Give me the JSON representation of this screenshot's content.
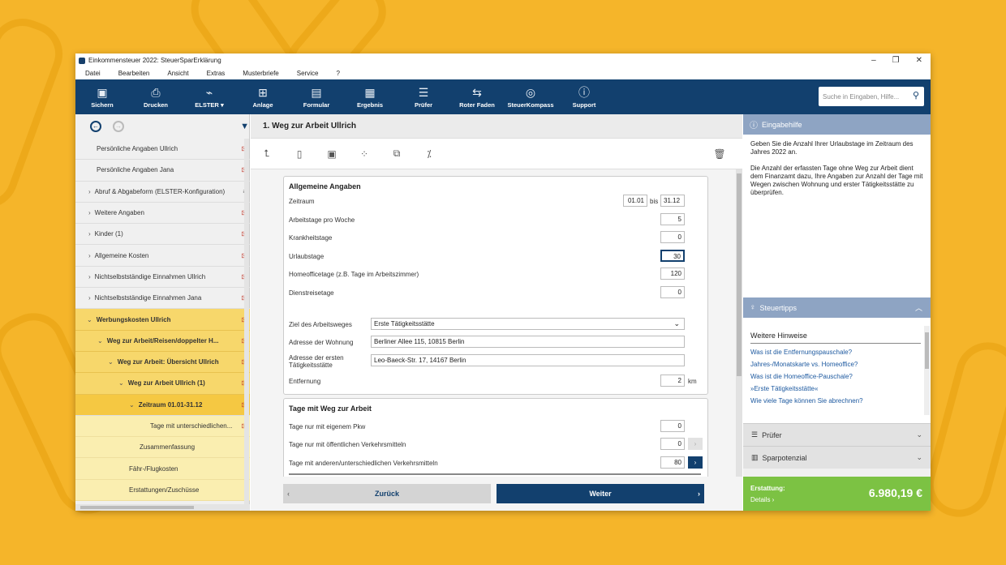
{
  "window": {
    "title": "Einkommensteuer 2022: SteuerSparErklärung"
  },
  "menu": [
    "Datei",
    "Bearbeiten",
    "Ansicht",
    "Extras",
    "Musterbriefe",
    "Service",
    "?"
  ],
  "toolbar": [
    {
      "label": "Sichern",
      "icon": "save-icon"
    },
    {
      "label": "Drucken",
      "icon": "print-icon"
    },
    {
      "label": "ELSTER",
      "icon": "elster-icon"
    },
    {
      "label": "Anlage",
      "icon": "add-document-icon"
    },
    {
      "label": "Formular",
      "icon": "form-icon"
    },
    {
      "label": "Ergebnis",
      "icon": "calculator-icon"
    },
    {
      "label": "Prüfer",
      "icon": "checklist-icon"
    },
    {
      "label": "Roter Faden",
      "icon": "signpost-icon"
    },
    {
      "label": "SteuerKompass",
      "icon": "compass-icon"
    },
    {
      "label": "Support",
      "icon": "help-icon"
    }
  ],
  "search": {
    "placeholder": "Suche in Eingaben, Hilfe..."
  },
  "tree": [
    {
      "label": "Persönliche Angaben Ullrich",
      "state": "normal"
    },
    {
      "label": "Persönliche Angaben Jana",
      "state": "normal"
    },
    {
      "label": "Abruf & Abgabeform (ELSTER-Konfiguration)",
      "state": "normal"
    },
    {
      "label": "Weitere Angaben",
      "state": "normal"
    },
    {
      "label": "Kinder (1)",
      "state": "normal"
    },
    {
      "label": "Allgemeine Kosten",
      "state": "normal"
    },
    {
      "label": "Nichtselbstständige Einnahmen Ullrich",
      "state": "normal"
    },
    {
      "label": "Nichtselbstständige Einnahmen Jana",
      "state": "normal"
    },
    {
      "label": "Werbungskosten Ullrich",
      "state": "sel"
    },
    {
      "label": "Weg zur Arbeit/Reisen/doppelter H...",
      "state": "sel"
    },
    {
      "label": "Weg zur Arbeit: Übersicht Ullrich",
      "state": "sel"
    },
    {
      "label": "Weg zur Arbeit Ullrich (1)",
      "state": "sel"
    },
    {
      "label": "Zeitraum 01.01-31.12",
      "state": "cur"
    },
    {
      "label": "Tage mit unterschiedlichen...",
      "state": "sub"
    },
    {
      "label": "Zusammenfassung",
      "state": "sub"
    },
    {
      "label": "Fähr-/Flugkosten",
      "state": "sub"
    },
    {
      "label": "Erstattungen/Zuschüsse",
      "state": "sub"
    }
  ],
  "page": {
    "title": "1. Weg zur Arbeit Ullrich"
  },
  "general": {
    "heading": "Allgemeine Angaben",
    "zeitraum_label": "Zeitraum",
    "zeitraum_from": "01.01",
    "bis": "bis",
    "zeitraum_to": "31.12",
    "arbeitstage_label": "Arbeitstage pro Woche",
    "arbeitstage": "5",
    "krank_label": "Krankheitstage",
    "krank": "0",
    "urlaub_label": "Urlaubstage",
    "urlaub": "30",
    "homeoffice_label": "Homeofficetage (z.B. Tage im Arbeitszimmer)",
    "homeoffice": "120",
    "dienstreise_label": "Dienstreisetage",
    "dienstreise": "0",
    "ziel_label": "Ziel des Arbeitsweges",
    "ziel": "Erste Tätigkeitsstätte",
    "wohnung_label": "Adresse der Wohnung",
    "wohnung": "Berliner Allee 115, 10815 Berlin",
    "taetig_label": "Adresse der ersten Tätigkeitsstätte",
    "taetig": "Leo-Baeck-Str. 17, 14167 Berlin",
    "entfernung_label": "Entfernung",
    "entfernung": "2",
    "km": "km"
  },
  "days": {
    "heading": "Tage mit Weg zur Arbeit",
    "pkw_label": "Tage nur mit eigenem Pkw",
    "pkw": "0",
    "oepnv_label": "Tage nur mit öffentlichen Verkehrsmitteln",
    "oepnv": "0",
    "andere_label": "Tage mit anderen/unterschiedlichen Verkehrsmitteln",
    "andere": "80"
  },
  "buttons": {
    "back": "Zurück",
    "next": "Weiter"
  },
  "help": {
    "title": "Eingabehilfe",
    "p1": "Geben Sie die Anzahl Ihrer Urlaubstage im Zeitraum des Jahres 2022 an.",
    "p2": "Die Anzahl der erfassten Tage ohne Weg zur Arbeit dient dem Finanzamt dazu, Ihre Angaben zur Anzahl der Tage mit Wegen zwischen Wohnung und erster Tätigkeitsstätte zu überprüfen."
  },
  "tips": {
    "title": "Steuertipps",
    "heading": "Weitere Hinweise",
    "links": [
      "Was ist die Entfernungspauschale?",
      "Jahres-/Monatskarte vs. Homeoffice?",
      "Was ist die Homeoffice-Pauschale?",
      "»Erste Tätigkeitsstätte«",
      "Wie viele Tage können Sie abrechnen?"
    ]
  },
  "pruefer": {
    "title": "Prüfer"
  },
  "sparpotenzial": {
    "title": "Sparpotenzial"
  },
  "refund": {
    "label": "Erstattung:",
    "details": "Details",
    "amount": "6.980,19 €"
  },
  "colors": {
    "primary": "#12406e",
    "accent_green": "#7cc243",
    "selection_yellow": "#f5c842"
  }
}
